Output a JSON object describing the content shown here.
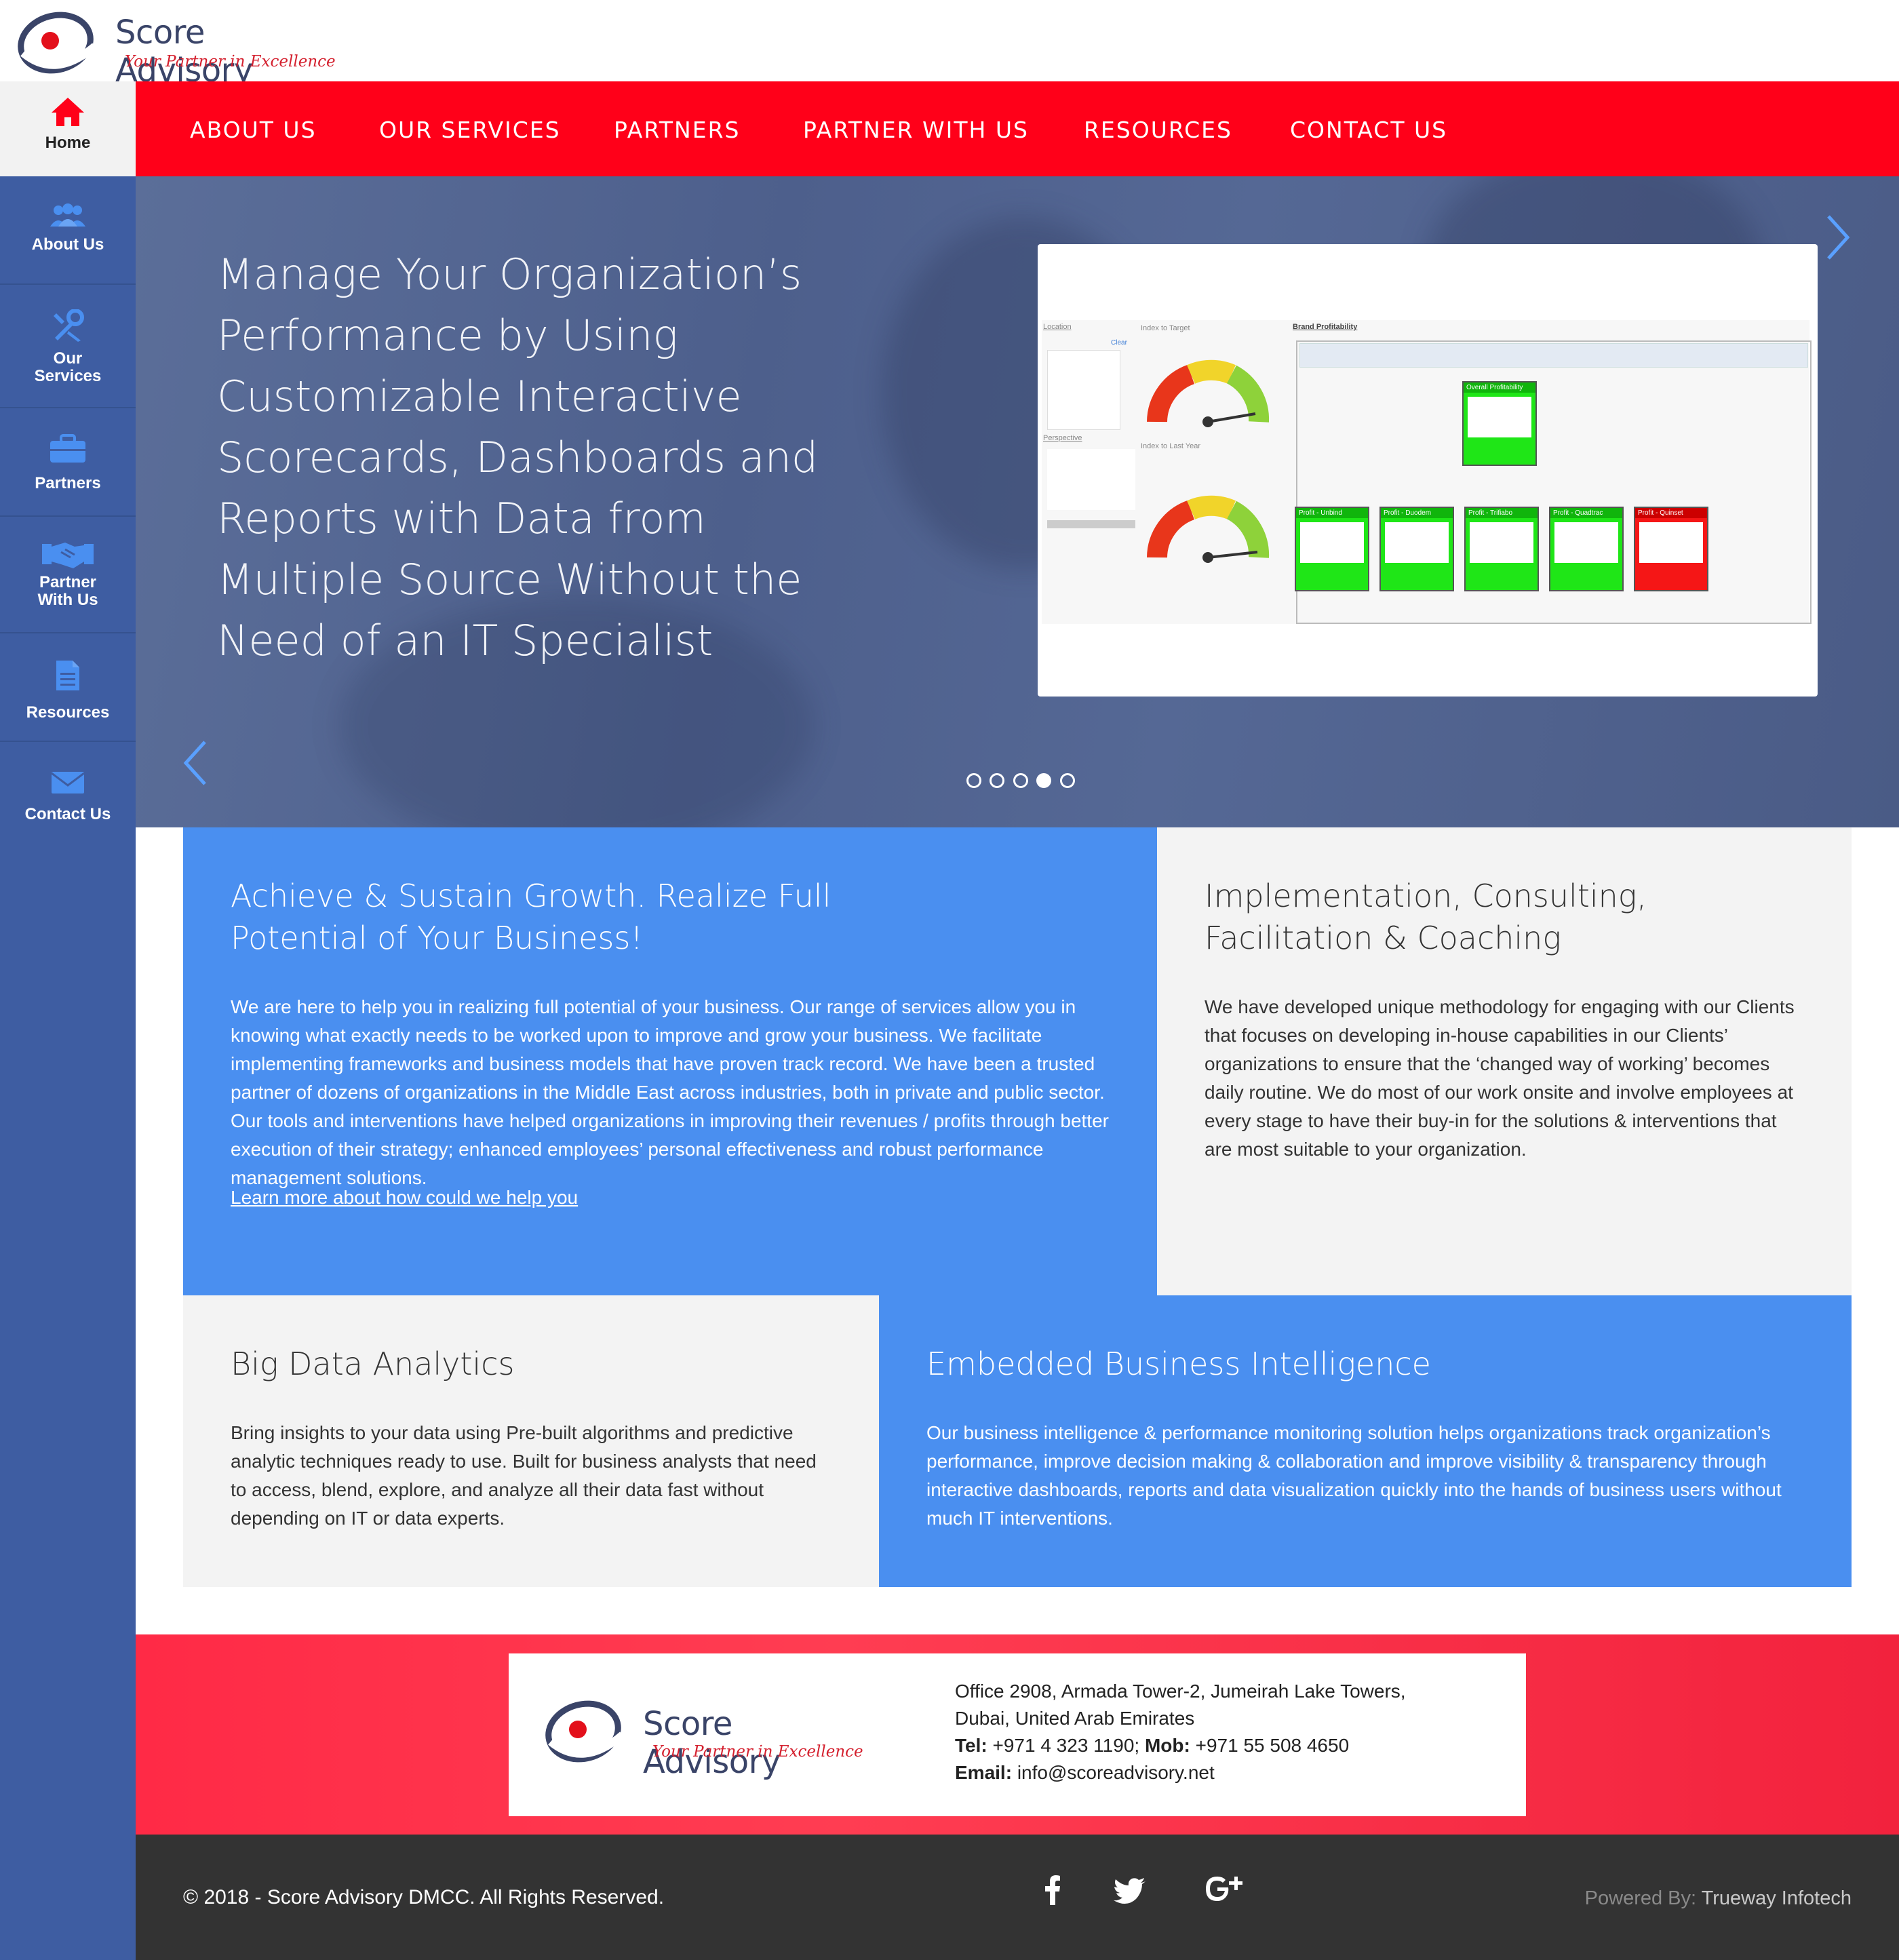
{
  "brand": {
    "name": "Score Advisory",
    "tagline": "Your Partner in Excellence"
  },
  "sidebar": {
    "items": [
      {
        "label": "Home",
        "icon": "home-icon"
      },
      {
        "label": "About Us",
        "icon": "users-icon"
      },
      {
        "label": "Our Services",
        "icon": "tools-icon"
      },
      {
        "label": "Partners",
        "icon": "briefcase-icon"
      },
      {
        "label": "Partner With Us",
        "icon": "handshake-icon"
      },
      {
        "label": "Resources",
        "icon": "document-icon"
      },
      {
        "label": "Contact Us",
        "icon": "envelope-icon"
      }
    ]
  },
  "nav": {
    "items": [
      "ABOUT US",
      "OUR SERVICES",
      "PARTNERS",
      "PARTNER WITH US",
      "RESOURCES",
      "CONTACT US"
    ]
  },
  "hero": {
    "title": "Manage Your Organization’s Performance by Using Customizable Interactive Scorecards, Dashboards and Reports with Data from Multiple Source Without the Need of an IT Specialist",
    "slides": 5,
    "active_slide": 4,
    "dashboard": {
      "panel_location": "Location",
      "panel_index_target": "Index to Target",
      "panel_index_last_year": "Index to Last Year",
      "panel_brand": "Brand Profitability",
      "panel_perspective": "Perspective",
      "clear": "Clear",
      "kpis": [
        "Overall Profitability",
        "Profit - Unbind",
        "Profit - Duodem",
        "Profit - Trifiabo",
        "Profit - Quadtrac",
        "Profit - Quinset"
      ]
    }
  },
  "blocks": {
    "growth": {
      "title": "Achieve & Sustain Growth. Realize Full Potential of Your Business!",
      "body": "We are here to help you in realizing full potential of your business. Our range of services allow you in knowing what exactly needs to be worked upon to improve and grow your business. We facilitate implementing frameworks and business models that have proven track record. We have been a trusted partner of dozens of organizations in the Middle East across industries, both in private and public sector. Our tools and interventions have helped organizations in improving their revenues / profits through better execution of their strategy; enhanced employees’ personal effectiveness and robust performance management solutions.",
      "link": "Learn more about how could we help you"
    },
    "implementation": {
      "title": "Implementation, Consulting, Facilitation & Coaching",
      "body": "We have developed unique methodology for engaging with our Clients that focuses on developing in-house capabilities in our Clients’ organizations to ensure that the ‘changed way of working’ becomes daily routine. We do most of our work onsite and involve employees at every stage to have their buy-in for the solutions & interventions that are most suitable to your organization."
    },
    "bigdata": {
      "title": "Big Data Analytics",
      "body": "Bring insights to your data using Pre-built algorithms and predictive analytic techniques ready to use. Built for business analysts that need to access, blend, explore, and analyze all their data fast without depending on IT or data experts."
    },
    "embedded": {
      "title": "Embedded Business Intelligence",
      "body": "Our business intelligence & performance monitoring solution helps organizations track organization’s performance, improve decision making & collaboration and improve visibility & transparency through interactive dashboards, reports and data visualization quickly into the hands of business users without much IT interventions."
    }
  },
  "contact": {
    "address1": "Office 2908, Armada Tower-2, Jumeirah Lake Towers,",
    "address2": "Dubai, United Arab Emirates",
    "tel_label": "Tel:",
    "tel": "+971 4 323 1190;",
    "mob_label": "Mob:",
    "mob": "+971 55 508 4650",
    "email_label": "Email:",
    "email": "info@scoreadvisory.net"
  },
  "footer": {
    "copyright": "© 2018 - Score Advisory DMCC. All Rights Reserved.",
    "powered_prefix": "Powered By:",
    "powered_by": "Trueway Infotech",
    "social": [
      "facebook-icon",
      "twitter-icon",
      "google-plus-icon"
    ]
  },
  "colors": {
    "accent_red": "#ff0019",
    "sidebar_blue": "#3e5da2",
    "block_blue": "#4a8ff0",
    "block_grey": "#f3f3f3",
    "footer_dark": "#333333"
  }
}
